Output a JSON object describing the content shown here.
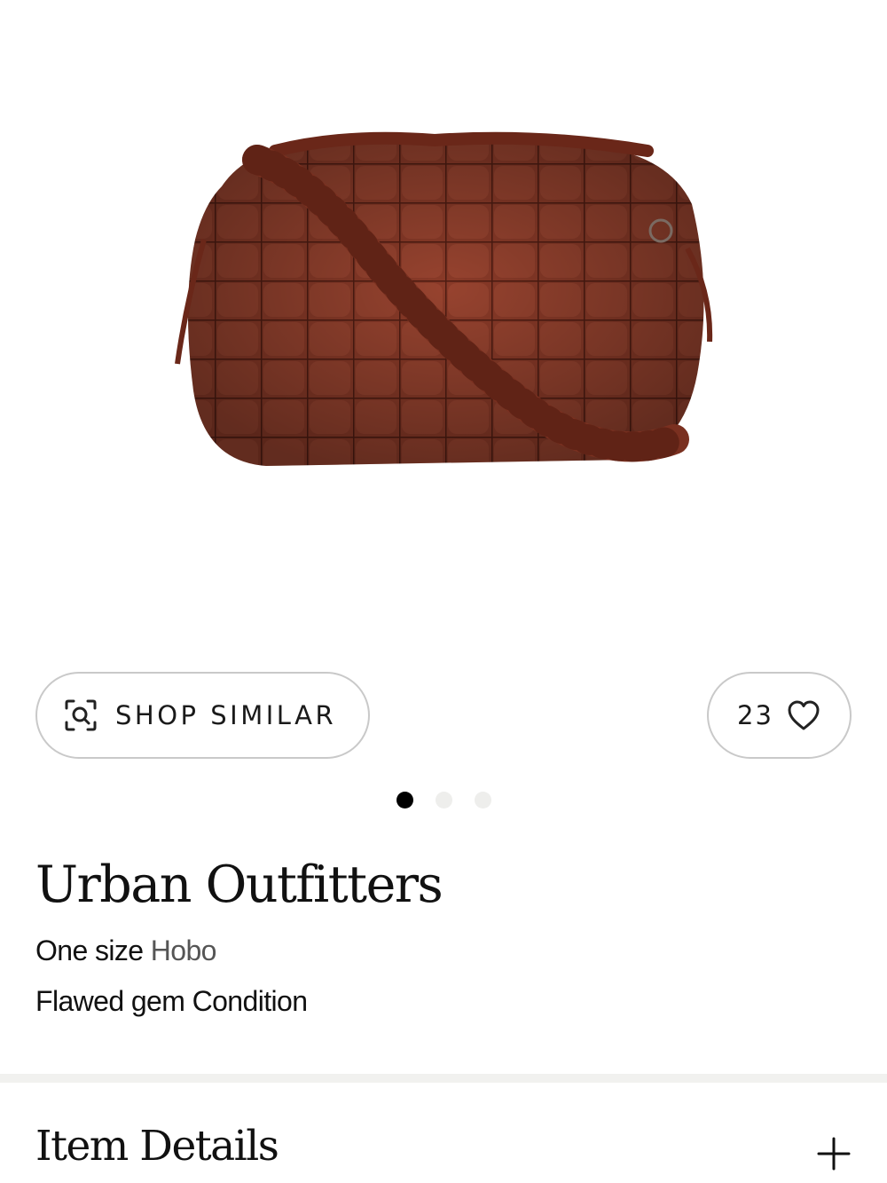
{
  "product": {
    "brand": "Urban Outfitters",
    "size": "One size",
    "category": "Hobo",
    "condition": "Flawed gem Condition",
    "image_alt": "Quilted rust-red hobo bag"
  },
  "actions": {
    "shop_similar_label": "SHOP SIMILAR",
    "shop_similar_icon": "visual-search-icon",
    "like_count": "23",
    "like_icon": "heart-outline-icon"
  },
  "gallery": {
    "total_images": 3,
    "active_index": 0
  },
  "sections": {
    "item_details_title": "Item Details",
    "expand_icon": "plus-icon"
  },
  "colors": {
    "bag_primary": "#8a3a28",
    "bag_shadow": "#5e2216",
    "active_dot": "#000000",
    "inactive_dot": "#eeeeec",
    "divider": "#f1f1ef"
  }
}
